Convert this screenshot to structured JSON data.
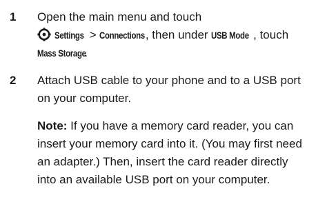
{
  "steps": [
    {
      "number": "1",
      "text_open": "Open the main menu and touch",
      "settings_label": "Settings",
      "separator": ">",
      "connections_label": "Connections",
      "text_then_under": ", then under",
      "usb_mode_label": "USB Mode",
      "text_touch": ", touch",
      "mass_storage_label": "Mass Storage",
      "period": "."
    },
    {
      "number": "2",
      "line1": "Attach USB cable to your phone and to a USB port",
      "line2": "on your computer.",
      "note": {
        "label": "Note:",
        "line1": " If you have a memory card reader, you can",
        "line2": "insert your memory card into it. (You may first need",
        "line3": "an adapter.) Then, insert the card reader directly",
        "line4": "into an available USB port on your computer."
      }
    }
  ],
  "icons": {
    "settings": "settings-icon"
  }
}
